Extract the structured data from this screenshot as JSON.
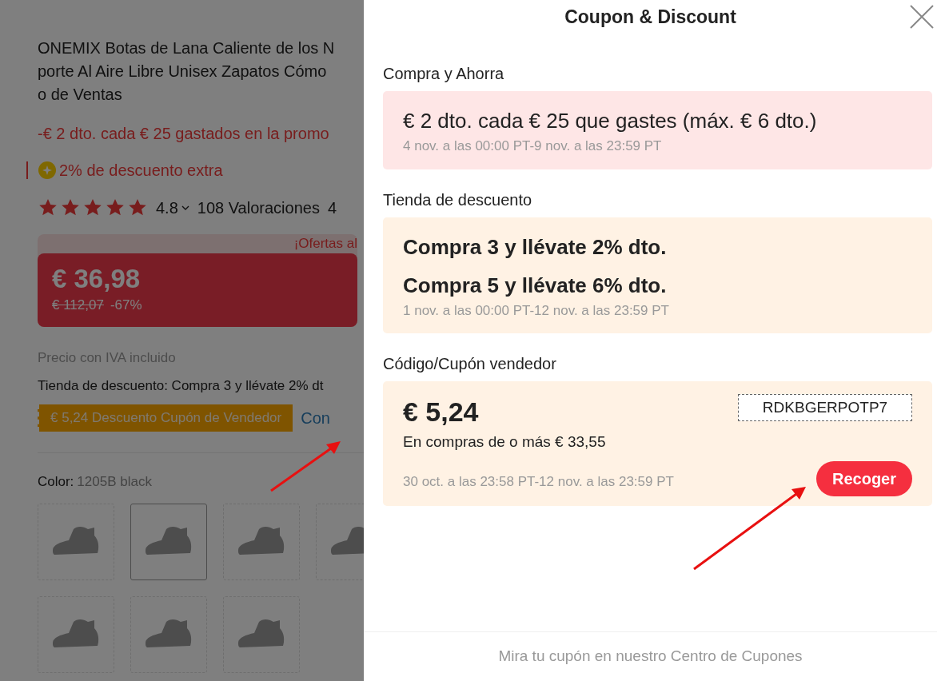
{
  "product": {
    "title_lines": [
      "ONEMIX Botas de Lana Caliente de los N",
      "porte Al Aire Libre Unisex Zapatos Cómo",
      "o de Ventas"
    ],
    "promo": "-€ 2 dto. cada € 25 gastados en la promo",
    "extra_discount": "2% de descuento extra",
    "stars": 5,
    "rating": "4.8",
    "reviews": "108 Valoraciones",
    "reviews_next": "4",
    "offer_banner": "¡Ofertas al",
    "price": "€ 36,98",
    "original_price": "€ 112,07",
    "discount": "-67%",
    "tax_note": "Precio con IVA incluido",
    "store_discount": "Tienda de descuento: Compra 3 y llévate 2% dt",
    "coupon_tag": "€ 5,24 Descuento Cupón de Vendedor",
    "coupon_link": "Con",
    "color_label": "Color:",
    "color_value": "1205B black",
    "swatches": [
      {
        "selected": false
      },
      {
        "selected": true
      },
      {
        "selected": false
      },
      {
        "selected": false
      },
      {
        "selected": false
      },
      {
        "selected": false
      },
      {
        "selected": false
      }
    ]
  },
  "panel": {
    "title": "Coupon & Discount",
    "sections": [
      {
        "heading": "Compra y Ahorra",
        "kind": "promo",
        "lines": [
          "€ 2 dto. cada € 25 que gastes (máx. € 6 dto.)"
        ],
        "period": "4 nov. a las 00:00 PT-9 nov. a las 23:59 PT"
      },
      {
        "heading": "Tienda de descuento",
        "kind": "store",
        "lines": [
          "Compra 3 y llévate 2% dto.",
          "Compra 5 y llévate 6% dto."
        ],
        "period": "1 nov. a las 00:00 PT-12 nov. a las 23:59 PT"
      },
      {
        "heading": "Código/Cupón vendedor",
        "kind": "coupon",
        "amount": "€ 5,24",
        "condition": "En compras de o más € 33,55",
        "code": "RDKBGERPOTP7",
        "button": "Recoger",
        "period": "30 oct. a las 23:58 PT-12 nov. a las 23:59 PT"
      }
    ],
    "footer": "Mira tu cupón en nuestro Centro de Cupones"
  }
}
